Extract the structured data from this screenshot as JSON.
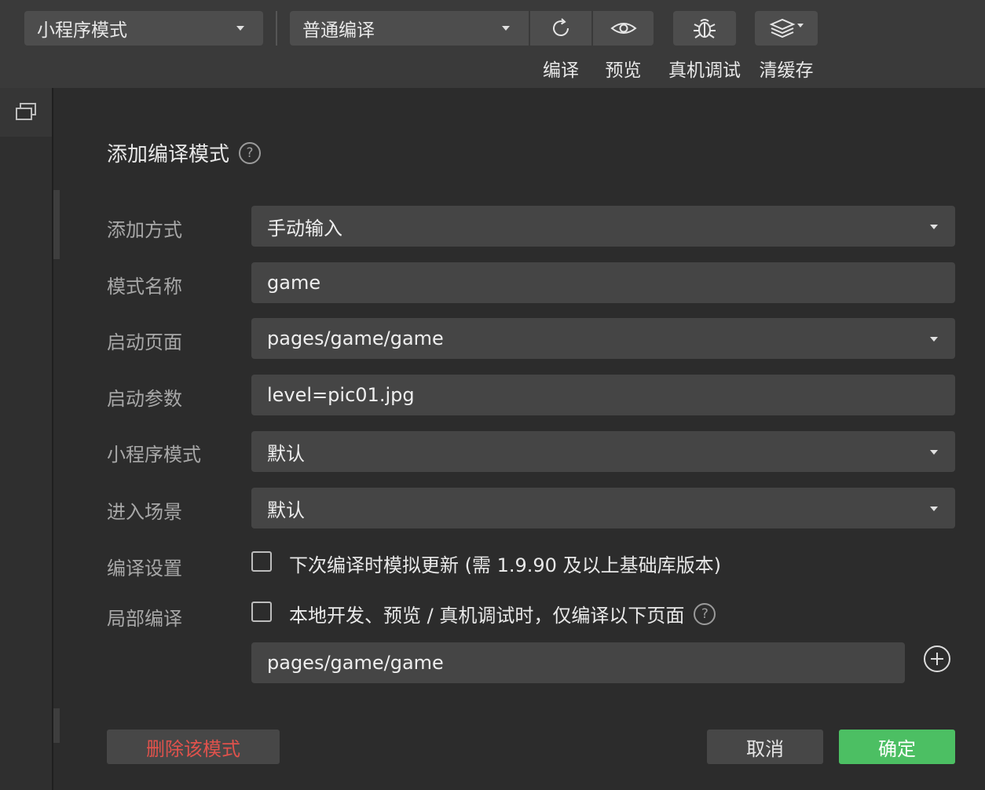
{
  "toolbar": {
    "mode_select": "小程序模式",
    "compile_select": "普通编译",
    "compile_label": "编译",
    "preview_label": "预览",
    "debug_label": "真机调试",
    "cache_label": "清缓存"
  },
  "dialog": {
    "title": "添加编译模式",
    "help": "?",
    "rows": {
      "add_method": {
        "label": "添加方式",
        "value": "手动输入"
      },
      "mode_name": {
        "label": "模式名称",
        "value": "game"
      },
      "start_page": {
        "label": "启动页面",
        "value": "pages/game/game"
      },
      "start_params": {
        "label": "启动参数",
        "value": "level=pic01.jpg"
      },
      "mini_mode": {
        "label": "小程序模式",
        "value": "默认"
      },
      "scene": {
        "label": "进入场景",
        "value": "默认"
      },
      "compile_settings": {
        "label": "编译设置",
        "checkbox_text": "下次编译时模拟更新 (需 1.9.90 及以上基础库版本)"
      },
      "partial_compile": {
        "label": "局部编译",
        "checkbox_text": "本地开发、预览 / 真机调试时，仅编译以下页面",
        "page": "pages/game/game"
      }
    },
    "buttons": {
      "delete": "删除该模式",
      "cancel": "取消",
      "confirm": "确定"
    }
  },
  "colors": {
    "danger": "#e0524c",
    "confirm": "#4cbf63",
    "toolbar_bg": "#3a3a3a",
    "panel_bg": "#2c2c2c"
  }
}
